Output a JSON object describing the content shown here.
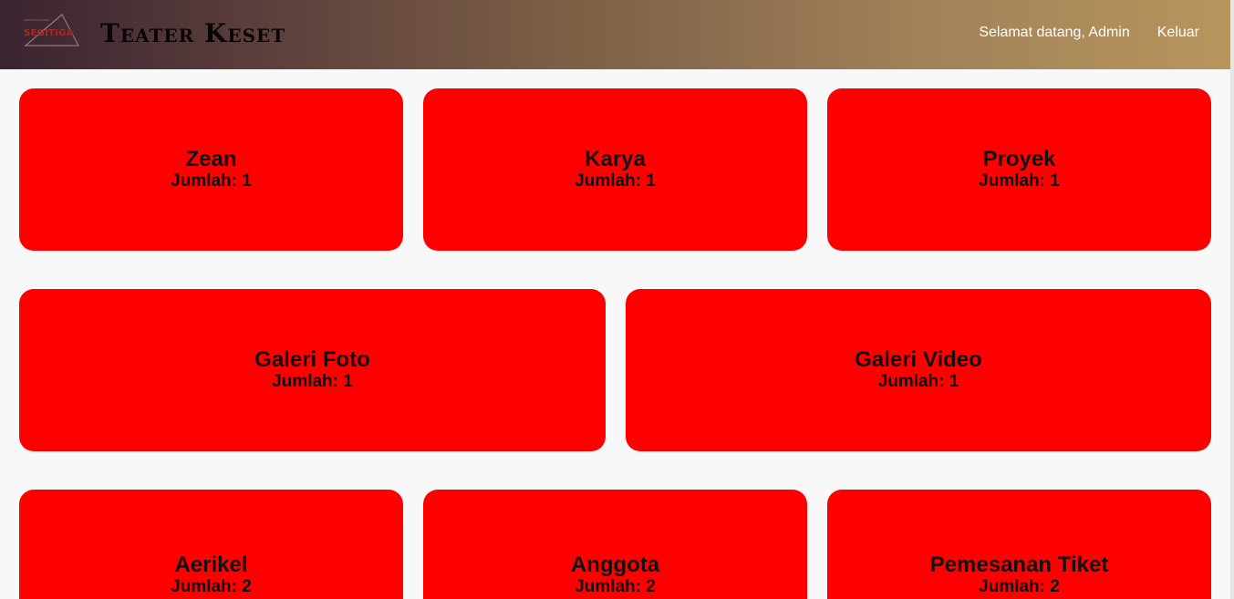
{
  "header": {
    "logo_text": "SEGITIGA",
    "title": "Teater Keset",
    "nav": {
      "welcome": "Selamat datang, Admin",
      "logout": "Keluar"
    }
  },
  "cards": [
    {
      "name": "Zean",
      "count": "Jumlah: 1"
    },
    {
      "name": "Karya",
      "count": "Jumlah: 1"
    },
    {
      "name": "Proyek",
      "count": "Jumlah: 1"
    },
    {
      "name": "Galeri Foto",
      "count": "Jumlah: 1"
    },
    {
      "name": "Galeri Video",
      "count": "Jumlah: 1"
    },
    {
      "name": "Aerikel",
      "count": "Jumlah: 2"
    },
    {
      "name": "Anggota",
      "count": "Jumlah: 2"
    },
    {
      "name": "Pemesanan Tiket",
      "count": "Jumlah: 2"
    }
  ],
  "colors": {
    "card": "#ff0000",
    "header_start": "#3a2430",
    "header_end": "#b8955c"
  }
}
